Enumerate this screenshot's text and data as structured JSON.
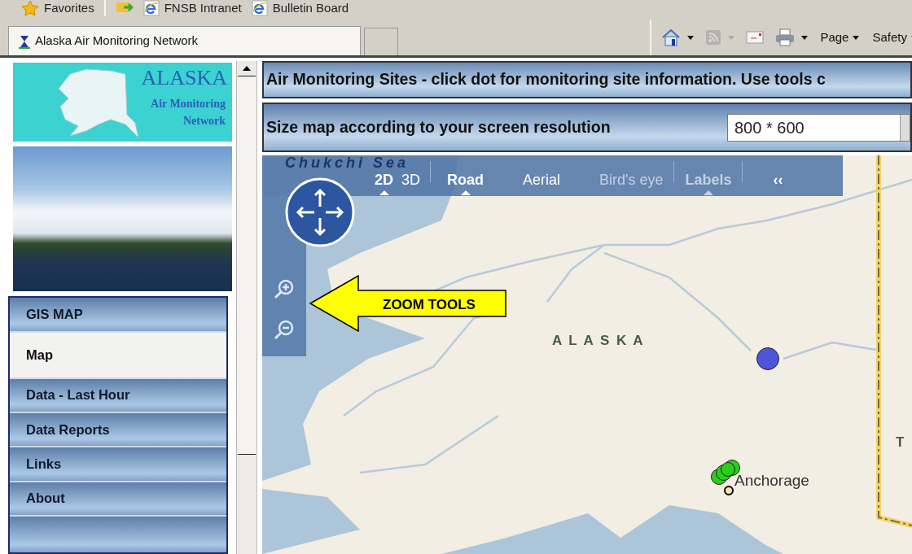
{
  "favorites_bar": {
    "items": [
      {
        "label": "Favorites",
        "kind": "favorites"
      },
      {
        "label": "FNSB Intranet",
        "kind": "link"
      },
      {
        "label": "Bulletin Board",
        "kind": "link"
      }
    ]
  },
  "tabs": [
    {
      "label": "Alaska Air Monitoring Network",
      "selected": true
    }
  ],
  "command_bar": {
    "items": [
      {
        "kind": "home",
        "disabled": false
      },
      {
        "kind": "feed",
        "disabled": true
      },
      {
        "kind": "mail",
        "disabled": false
      },
      {
        "kind": "print",
        "disabled": false
      },
      {
        "kind": "menu",
        "label": "Page",
        "disabled": false
      },
      {
        "kind": "menu",
        "label": "Safety",
        "disabled": false
      }
    ]
  },
  "logo": {
    "title": "ALASKA",
    "subtitle_lines": [
      "Air Monitoring",
      "Network"
    ]
  },
  "sidebar": {
    "items": [
      {
        "label": "GIS MAP",
        "selected": false
      },
      {
        "label": "Map",
        "selected": true
      },
      {
        "label": "Data - Last Hour",
        "selected": false
      },
      {
        "label": "Data Reports",
        "selected": false
      },
      {
        "label": "Links",
        "selected": false
      },
      {
        "label": "About",
        "selected": false
      }
    ]
  },
  "header": {
    "text": "Air Monitoring Sites - click dot for monitoring site information. Use tools c"
  },
  "resolution": {
    "label": "Size map according to your screen resolution",
    "value": "800 * 600"
  },
  "map": {
    "toolbar": [
      {
        "label": "2D",
        "selected": true,
        "disabled": false,
        "divider_after": false
      },
      {
        "label": "3D",
        "selected": false,
        "disabled": false,
        "divider_after": true
      },
      {
        "label": "Road",
        "selected": true,
        "disabled": false,
        "divider_after": false
      },
      {
        "label": "Aerial",
        "selected": false,
        "disabled": false,
        "divider_after": false
      },
      {
        "label": "Bird's eye",
        "selected": false,
        "disabled": true,
        "divider_after": true
      },
      {
        "label": "Labels",
        "selected": true,
        "disabled": true,
        "divider_after": true
      }
    ],
    "collapse": "‹‹",
    "labels": [
      {
        "text": "Chukchi Sea",
        "kind": "sea"
      },
      {
        "text": "A L A S K A",
        "kind": "region"
      },
      {
        "text": "Anchorage",
        "kind": "city"
      },
      {
        "text": "T",
        "kind": "region"
      }
    ],
    "sites": [
      {
        "color": "#4f55d9"
      },
      {
        "color": "#2ccc1c"
      },
      {
        "color": "#2ccc1c"
      },
      {
        "color": "#2ccc1c"
      },
      {
        "color": "#2ccc1c"
      }
    ],
    "callout": {
      "text": "ZOOM TOOLS"
    }
  }
}
